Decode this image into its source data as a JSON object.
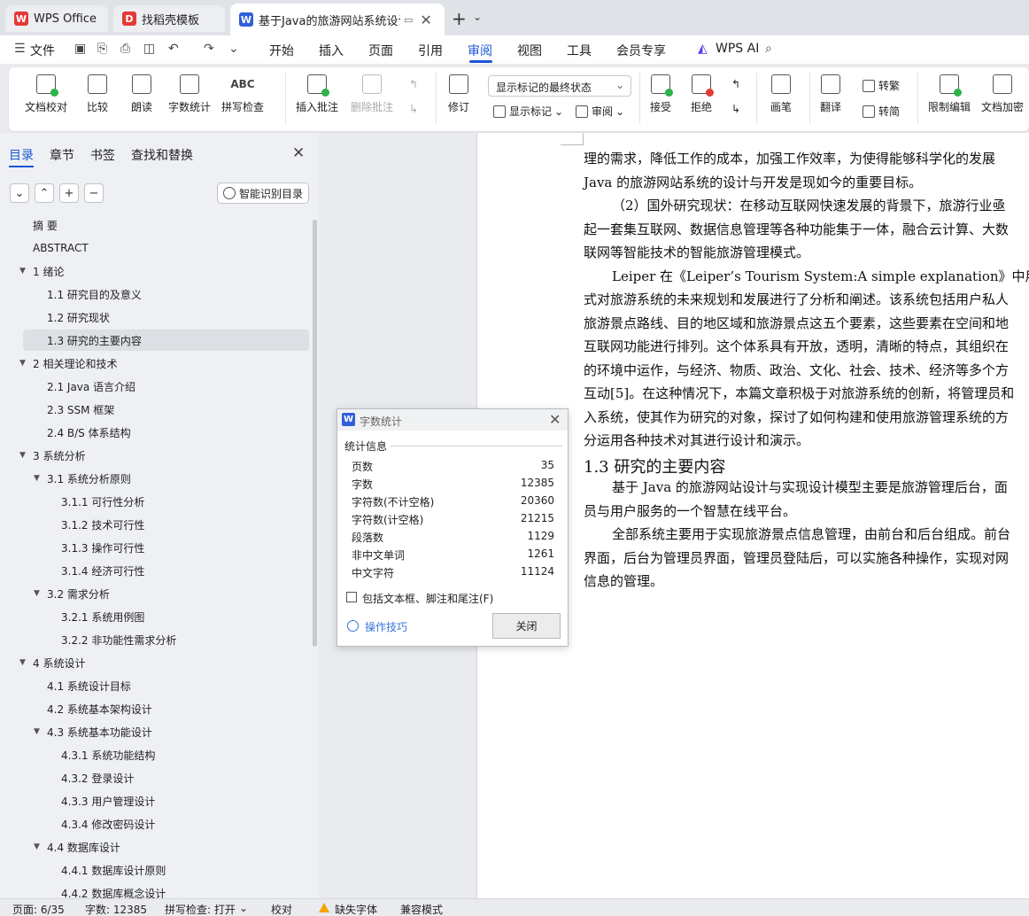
{
  "tabs": {
    "wps": {
      "icon": "wps-logo-icon",
      "label": "WPS Office"
    },
    "templates": {
      "icon": "docer-icon",
      "label": "找稻壳模板"
    },
    "document": {
      "icon": "writer-icon",
      "label": "基于Java的旅游网站系统设计与"
    },
    "new_tab": "+",
    "new_tab_menu": "⌄"
  },
  "menubar": {
    "file": "文件",
    "items": [
      "开始",
      "插入",
      "页面",
      "引用",
      "审阅",
      "视图",
      "工具",
      "会员专享"
    ],
    "active": "审阅",
    "wps_ai": "WPS AI"
  },
  "ribbon": {
    "doc_check": "文档校对",
    "compare": "比较",
    "read_aloud": "朗读",
    "word_count": "字数统计",
    "spell_check": "拼写检查",
    "insert_comment": "插入批注",
    "delete_comment": "删除批注",
    "track_changes": "修订",
    "show_markup": "显示标记",
    "review_pane": "审阅",
    "markup_mode": "显示标记的最终状态",
    "accept": "接受",
    "reject": "拒绝",
    "pen": "画笔",
    "translate": "翻译",
    "to_traditional": "转繁",
    "to_simplified": "转简",
    "restrict_edit": "限制编辑",
    "encrypt": "文档加密"
  },
  "nav": {
    "tabs": [
      "目录",
      "章节",
      "书签",
      "查找和替换"
    ],
    "active_tab": "目录",
    "smart_toc": "智能识别目录",
    "toc": [
      {
        "label": "摘  要",
        "level": 0,
        "arrow": false
      },
      {
        "label": "ABSTRACT",
        "level": 0,
        "arrow": false
      },
      {
        "label": "1  绪论",
        "level": 0,
        "arrow": true
      },
      {
        "label": "1.1  研究目的及意义",
        "level": 1,
        "arrow": false
      },
      {
        "label": "1.2  研究现状",
        "level": 1,
        "arrow": false
      },
      {
        "label": "1.3  研究的主要内容",
        "level": 1,
        "arrow": false,
        "selected": true
      },
      {
        "label": "2  相关理论和技术",
        "level": 0,
        "arrow": true
      },
      {
        "label": "2.1 Java 语言介绍",
        "level": 1,
        "arrow": false
      },
      {
        "label": "2.3 SSM 框架",
        "level": 1,
        "arrow": false
      },
      {
        "label": "2.4 B/S 体系结构",
        "level": 1,
        "arrow": false
      },
      {
        "label": "3  系统分析",
        "level": 0,
        "arrow": true
      },
      {
        "label": "3.1  系统分析原则",
        "level": 1,
        "arrow": true
      },
      {
        "label": "3.1.1  可行性分析",
        "level": 2,
        "arrow": false
      },
      {
        "label": "3.1.2  技术可行性",
        "level": 2,
        "arrow": false
      },
      {
        "label": "3.1.3  操作可行性",
        "level": 2,
        "arrow": false
      },
      {
        "label": "3.1.4  经济可行性",
        "level": 2,
        "arrow": false
      },
      {
        "label": "3.2  需求分析",
        "level": 1,
        "arrow": true
      },
      {
        "label": "3.2.1  系统用例图",
        "level": 2,
        "arrow": false
      },
      {
        "label": "3.2.2  非功能性需求分析",
        "level": 2,
        "arrow": false
      },
      {
        "label": "4  系统设计",
        "level": 0,
        "arrow": true
      },
      {
        "label": "4.1  系统设计目标",
        "level": 1,
        "arrow": false
      },
      {
        "label": "4.2  系统基本架构设计",
        "level": 1,
        "arrow": false
      },
      {
        "label": "4.3  系统基本功能设计",
        "level": 1,
        "arrow": true
      },
      {
        "label": "4.3.1 系统功能结构",
        "level": 2,
        "arrow": false
      },
      {
        "label": "4.3.2  登录设计",
        "level": 2,
        "arrow": false
      },
      {
        "label": "4.3.3  用户管理设计",
        "level": 2,
        "arrow": false
      },
      {
        "label": "4.3.4  修改密码设计",
        "level": 2,
        "arrow": false
      },
      {
        "label": "4.4  数据库设计",
        "level": 1,
        "arrow": true
      },
      {
        "label": "4.4.1  数据库设计原则",
        "level": 2,
        "arrow": false
      },
      {
        "label": "4.4.2  数据库概念设计",
        "level": 2,
        "arrow": false
      }
    ]
  },
  "document": {
    "lines": [
      "理的需求，降低工作的成本，加强工作效率，为使得能够科学化的发展",
      "Java 的旅游网站系统的设计与开发是现如今的重要目标。",
      "（2）国外研究现状：在移动互联网快速发展的背景下，旅游行业亟",
      "起一套集互联网、数据信息管理等各种功能集于一体，融合云计算、大数",
      "联网等智能技术的智能旅游管理模式。",
      "Leiper 在《Leiper’s Tourism System:A simple explanation》中用计算",
      "式对旅游系统的未来规划和发展进行了分析和阐述。该系统包括用户私人",
      "旅游景点路线、目的地区域和旅游景点这五个要素，这些要素在空间和地",
      "互联网功能进行排列。这个体系具有开放，透明，清晰的特点，其组织在",
      "的环境中运作，与经济、物质、政治、文化、社会、技术、经济等多个方",
      "互动[5]。在这种情况下，本篇文章积极于对旅游系统的创新，将管理员和",
      "入系统，使其作为研究的对象，探讨了如何构建和使用旅游管理系统的方",
      "分运用各种技术对其进行设计和演示。"
    ],
    "heading": "1.3  研究的主要内容",
    "lines_after": [
      "基于 Java 的旅游网站设计与实现设计模型主要是旅游管理后台，面",
      "员与用户服务的一个智慧在线平台。",
      "全部系统主要用于实现旅游景点信息管理，由前台和后台组成。前台",
      "界面，后台为管理员界面，管理员登陆后，可以实施各种操作，实现对网",
      "信息的管理。"
    ]
  },
  "dialog": {
    "title": "字数统计",
    "section": "统计信息",
    "stats": [
      {
        "label": "页数",
        "value": "35"
      },
      {
        "label": "字数",
        "value": "12385"
      },
      {
        "label": "字符数(不计空格)",
        "value": "20360"
      },
      {
        "label": "字符数(计空格)",
        "value": "21215"
      },
      {
        "label": "段落数",
        "value": "1129"
      },
      {
        "label": "非中文单词",
        "value": "1261"
      },
      {
        "label": "中文字符",
        "value": "11124"
      }
    ],
    "include_label": "包括文本框、脚注和尾注(F)",
    "include_checked": false,
    "tips": "操作技巧",
    "close": "关闭"
  },
  "statusbar": {
    "page": "页面: 6/35",
    "words": "字数: 12385",
    "spell": "拼写检查: 打开",
    "proof": "校对",
    "missing_font": "缺失字体",
    "compat": "兼容模式"
  },
  "colors": {
    "accent": "#1a55d6",
    "wps_red": "#e53935",
    "writer_blue": "#2f5fd8",
    "warning": "#f0a500"
  }
}
